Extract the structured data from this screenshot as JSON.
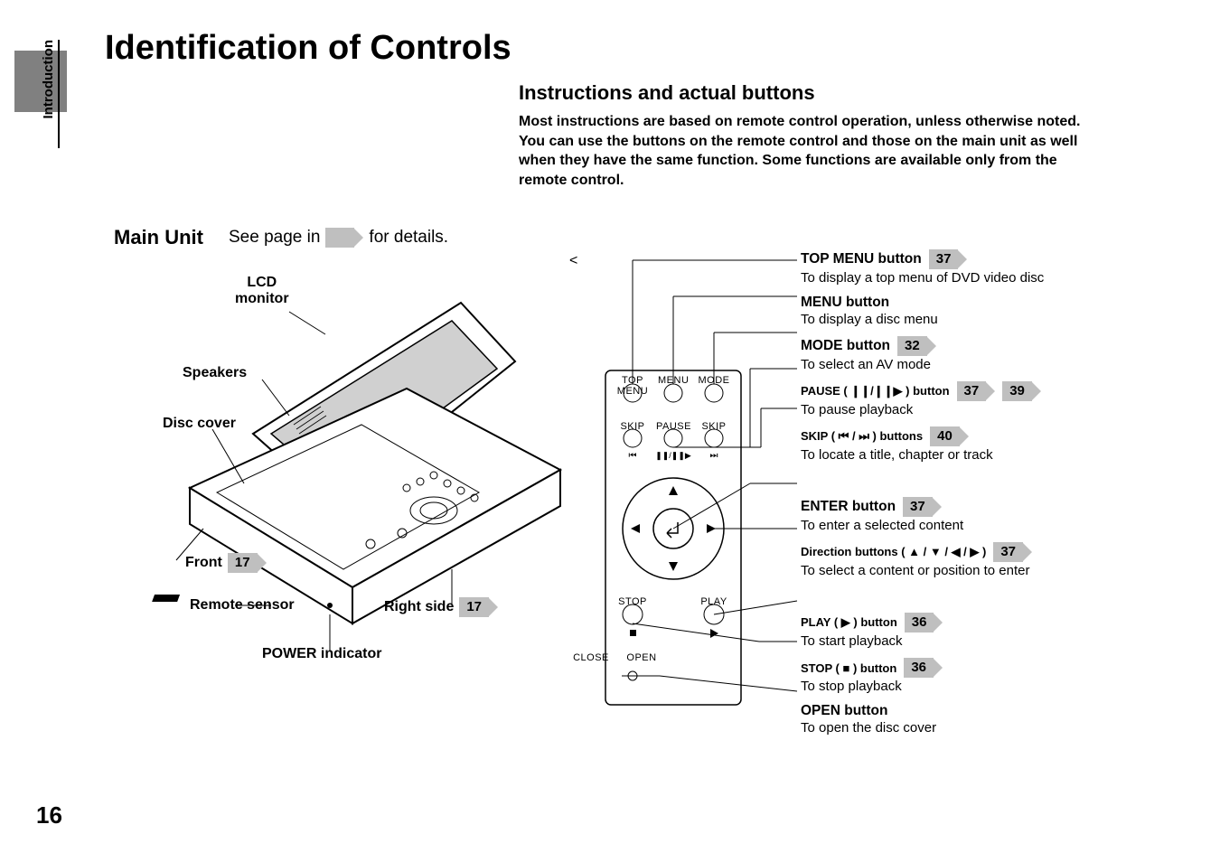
{
  "section_tab": "Introduction",
  "page_title": "Identification of Controls",
  "instructions_heading": "Instructions and actual buttons",
  "instructions_body": "Most instructions are based on remote control operation, unless otherwise noted. You can use the buttons on the remote control and those on the main unit as well when they have the same function. Some functions are available only from the remote control.",
  "main_unit": {
    "label": "Main Unit",
    "see_page_prefix": "See page in",
    "see_page_suffix": "for details."
  },
  "left_labels": {
    "lcd_monitor_l1": "LCD",
    "lcd_monitor_l2": "monitor",
    "speakers": "Speakers",
    "disc_cover": "Disc cover",
    "front": "Front",
    "front_page": "17",
    "remote_sensor": "Remote sensor",
    "power_indicator": "POWER indicator",
    "right_side": "Right side",
    "right_side_page": "17"
  },
  "panel_labels": {
    "top_menu": "TOP MENU",
    "menu": "MENU",
    "mode": "MODE",
    "skip_l": "SKIP",
    "pause": "PAUSE",
    "skip_r": "SKIP",
    "stop": "STOP",
    "play": "PLAY",
    "close": "CLOSE",
    "open": "OPEN"
  },
  "callouts": [
    {
      "title": "TOP MENU button",
      "pages": [
        "37"
      ],
      "desc": "To display a top menu of DVD video disc"
    },
    {
      "title": "MENU button",
      "pages": [],
      "desc": "To display a disc menu"
    },
    {
      "title": "MODE button",
      "pages": [
        "32"
      ],
      "desc": "To select an AV mode"
    },
    {
      "title": "PAUSE ( ❙❙/❙❙▶ ) button",
      "pages": [
        "37",
        "39"
      ],
      "desc": "To pause playback"
    },
    {
      "title": "SKIP ( ⏮ / ⏭ ) buttons",
      "pages": [
        "40"
      ],
      "desc": "To locate a title, chapter or track"
    },
    {
      "title": "ENTER button",
      "pages": [
        "37"
      ],
      "desc": "To enter a selected content"
    },
    {
      "title": "Direction buttons ( ▲ / ▼ / ◀ / ▶ )",
      "pages": [
        "37"
      ],
      "desc": "To select a content or position to enter"
    },
    {
      "title": "PLAY ( ▶ ) button",
      "pages": [
        "36"
      ],
      "desc": "To start playback"
    },
    {
      "title": "STOP ( ■ ) button",
      "pages": [
        "36"
      ],
      "desc": "To stop playback"
    },
    {
      "title": "OPEN button",
      "pages": [],
      "desc": "To open the disc cover"
    }
  ],
  "page_number": "16"
}
